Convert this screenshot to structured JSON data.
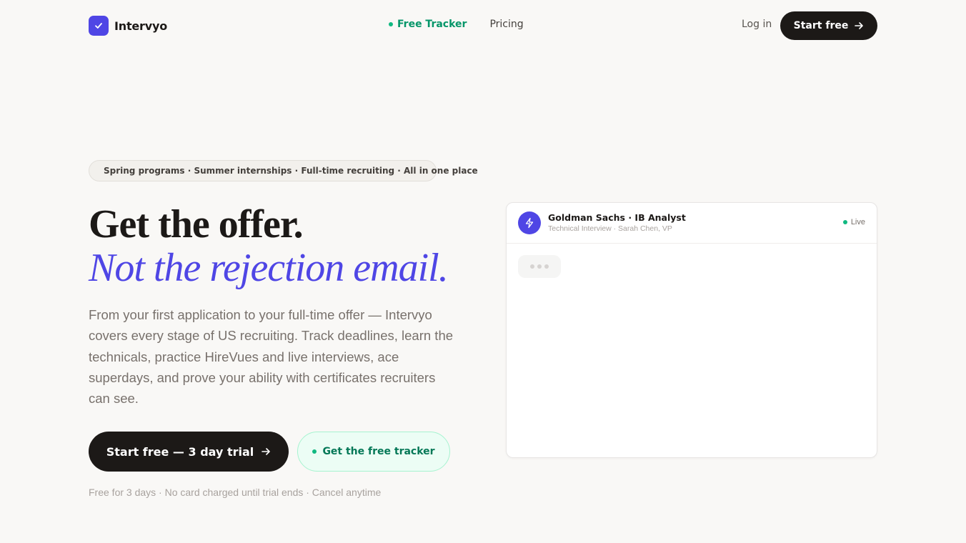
{
  "nav": {
    "brand": "Intervyo",
    "links": [
      {
        "label": "Free Tracker",
        "active": true
      },
      {
        "label": "Pricing",
        "active": false
      }
    ],
    "login": "Log in",
    "cta": "Start free"
  },
  "hero": {
    "pill": "Spring programs · Summer internships · Full-time recruiting · All in one place",
    "headline": "Get the offer.",
    "headline_accent": "Not the rejection email.",
    "lede": "From your first application to your full-time offer — Intervyo covers every stage of US recruiting. Track deadlines, learn the technicals, practice HireVues and live interviews, ace superdays, and prove your ability with certificates recruiters can see.",
    "cta_primary": "Start free — 3 day trial",
    "cta_secondary": "Get the free tracker",
    "fine_print": "Free for 3 days · No card charged until trial ends · Cancel anytime"
  },
  "demo_card": {
    "title": "Goldman Sachs · IB Analyst",
    "subtitle": "Technical Interview · Sarah Chen, VP",
    "status": "Live",
    "avatar_icon": "lightning-icon",
    "typing_indicator": "typing-dots-icon"
  },
  "colors": {
    "accent": "#4f46e5",
    "dark": "#1c1917",
    "green": "#10b981",
    "background": "#f9f8f6"
  }
}
